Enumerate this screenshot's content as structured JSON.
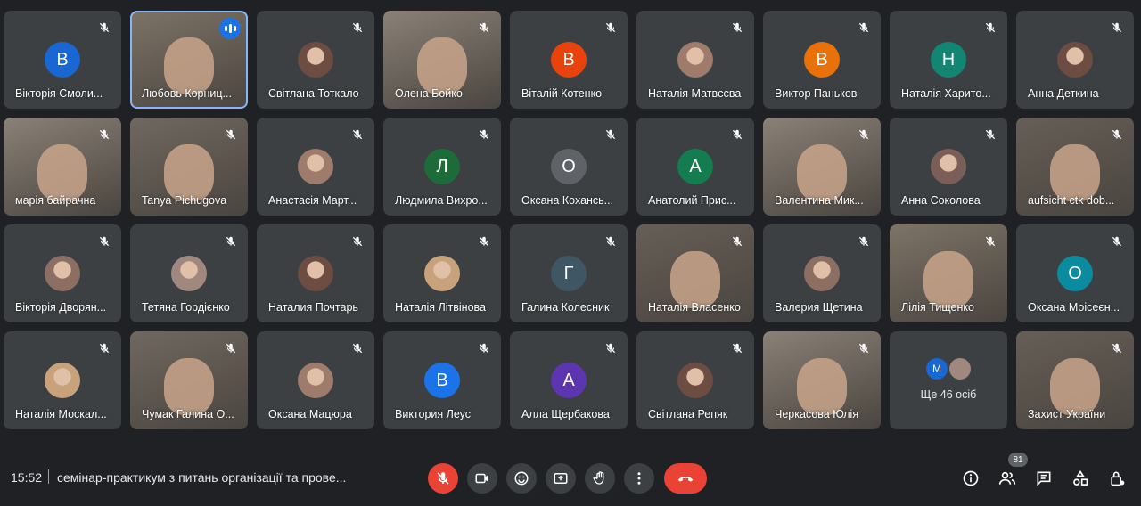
{
  "participants": [
    {
      "name": "Вікторія Смоли...",
      "initial": "В",
      "color": "#1967d2",
      "kind": "letter"
    },
    {
      "name": "Любовь Корниц...",
      "kind": "video",
      "active": true,
      "speaking": true
    },
    {
      "name": "Світлана Тоткало",
      "kind": "photo"
    },
    {
      "name": "Олена Бойко",
      "kind": "video"
    },
    {
      "name": "Віталій Котенко",
      "initial": "В",
      "color": "#e8430d",
      "kind": "letter"
    },
    {
      "name": "Наталія Матвєєва",
      "kind": "photo"
    },
    {
      "name": "Виктор Паньков",
      "initial": "В",
      "color": "#e8710a",
      "kind": "letter"
    },
    {
      "name": "Наталія Харито...",
      "initial": "Н",
      "color": "#128573",
      "kind": "letter"
    },
    {
      "name": "Анна Деткина",
      "kind": "photo"
    },
    {
      "name": "марія байрачна",
      "kind": "video"
    },
    {
      "name": "Tanya Pichugova",
      "kind": "video"
    },
    {
      "name": "Анастасія Март...",
      "kind": "photo"
    },
    {
      "name": "Людмила Вихро...",
      "initial": "Л",
      "color": "#1e6b3a",
      "kind": "letter"
    },
    {
      "name": "Оксана Кохансь...",
      "initial": "О",
      "color": "#5f6368",
      "kind": "letter"
    },
    {
      "name": "Анатолий Прис...",
      "initial": "А",
      "color": "#137d4f",
      "kind": "letter"
    },
    {
      "name": "Валентина Мик...",
      "kind": "video"
    },
    {
      "name": "Анна Соколова",
      "kind": "photo"
    },
    {
      "name": "aufsicht ctk dob...",
      "kind": "video"
    },
    {
      "name": "Вікторія Дворян...",
      "kind": "photo"
    },
    {
      "name": "Тетяна Гордієнко",
      "kind": "photo"
    },
    {
      "name": "Наталия Почтарь",
      "kind": "photo"
    },
    {
      "name": "Наталія Літвінова",
      "kind": "photo"
    },
    {
      "name": "Галина Колесник",
      "initial": "Г",
      "color": "#3f5665",
      "kind": "letter"
    },
    {
      "name": "Наталія Власенко",
      "kind": "video"
    },
    {
      "name": "Валерия Щетина",
      "kind": "photo"
    },
    {
      "name": "Лілія Тищенко",
      "kind": "video"
    },
    {
      "name": "Оксана Моісеєн...",
      "initial": "О",
      "color": "#0b8ba0",
      "kind": "letter"
    },
    {
      "name": "Наталія Москал...",
      "kind": "photo"
    },
    {
      "name": "Чумак Галина О...",
      "kind": "video"
    },
    {
      "name": "Оксана Мацюра",
      "kind": "photo"
    },
    {
      "name": "Виктория Леус",
      "initial": "В",
      "color": "#1a73e8",
      "kind": "letter"
    },
    {
      "name": "Алла Щербакова",
      "initial": "А",
      "color": "#5e35b1",
      "kind": "letter"
    },
    {
      "name": "Світлана Репяк",
      "kind": "photo"
    },
    {
      "name": "Черкасова Юлія",
      "kind": "video"
    },
    {
      "name": "",
      "kind": "more"
    },
    {
      "name": "Захист України",
      "kind": "video"
    }
  ],
  "more_tile": {
    "initial": "М",
    "color": "#1967d2",
    "label": "Ще 46 осіб"
  },
  "bottom": {
    "time": "15:52",
    "meeting_title": "семінар-практикум з питань організації та прове...",
    "participant_count": "81"
  },
  "colors": {
    "background": "#202124",
    "tile": "#3c4043",
    "accent_red": "#ea4335",
    "speaking_blue": "#1a73e8"
  },
  "icons": [
    "mic-off-icon",
    "camera-icon",
    "emoji-icon",
    "present-icon",
    "raise-hand-icon",
    "more-options-icon",
    "end-call-icon",
    "info-icon",
    "people-icon",
    "chat-icon",
    "activities-icon",
    "host-controls-icon"
  ]
}
